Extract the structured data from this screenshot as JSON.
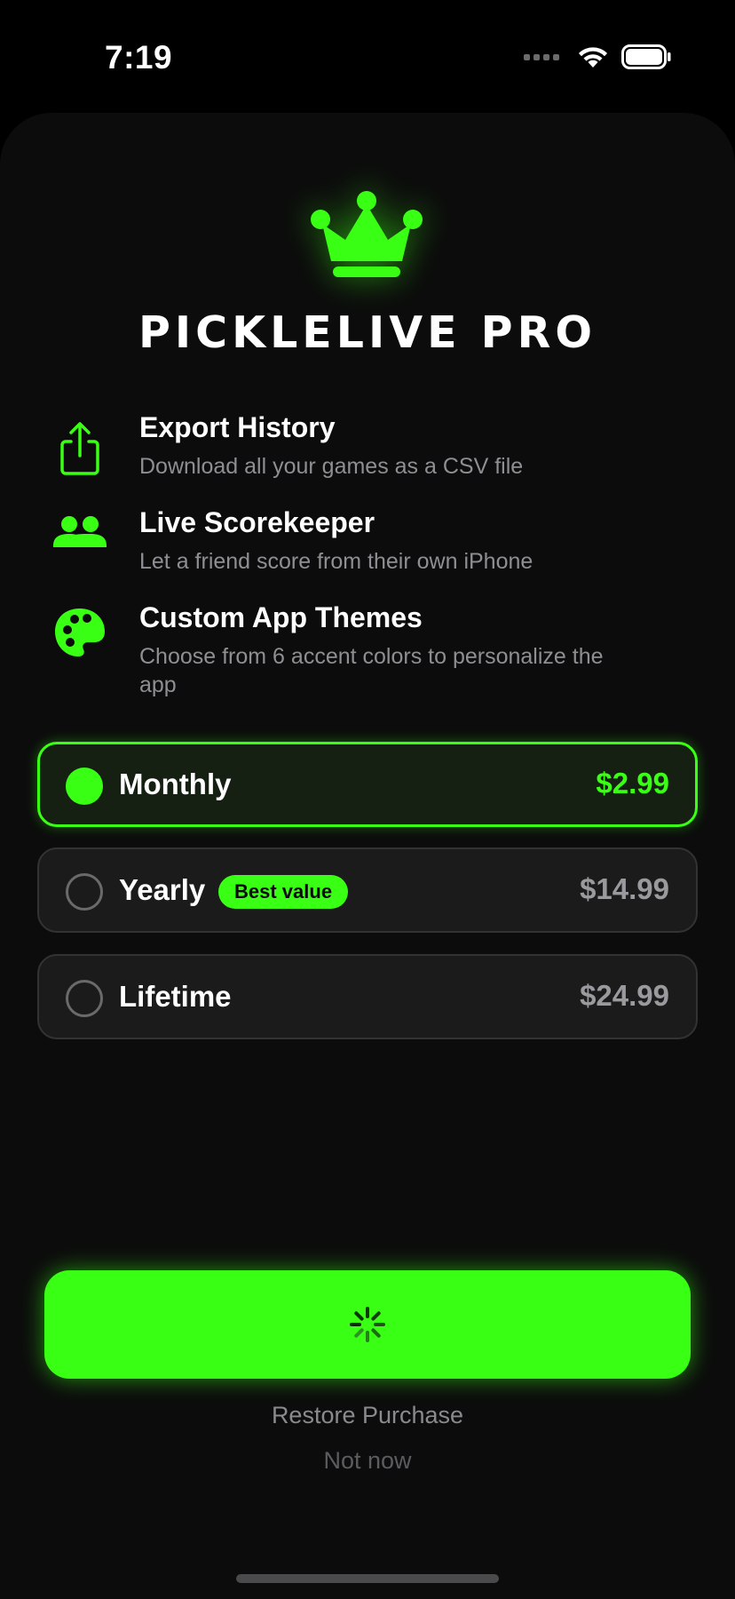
{
  "status_bar": {
    "time": "7:19",
    "icons": [
      "cellular-dots-icon",
      "wifi-icon",
      "battery-icon"
    ]
  },
  "paywall": {
    "title": "PICKLELIVE PRO",
    "hero_icon": "crown-icon",
    "features": [
      {
        "icon": "share-export-icon",
        "title": "Export History",
        "description": "Download all your games as a CSV file"
      },
      {
        "icon": "people-icon",
        "title": "Live Scorekeeper",
        "description": "Let a friend score from their own iPhone"
      },
      {
        "icon": "palette-icon",
        "title": "Custom App Themes",
        "description": "Choose from 6 accent colors to personalize the app"
      }
    ],
    "plans": [
      {
        "label": "Monthly",
        "price": "$2.99",
        "selected": true
      },
      {
        "label": "Yearly",
        "price": "$14.99",
        "badge": "Best value",
        "selected": false
      },
      {
        "label": "Lifetime",
        "price": "$24.99",
        "selected": false
      }
    ],
    "purchase_button": {
      "state": "loading",
      "icon": "activity-spinner-icon"
    },
    "restore_label": "Restore Purchase",
    "dismiss_label": "Not now"
  },
  "colors": {
    "accent": "#39FF14",
    "background": "#000000",
    "sheet": "#0C0C0C",
    "card": "#1B1B1C",
    "secondary_text": "#8E8E93"
  }
}
